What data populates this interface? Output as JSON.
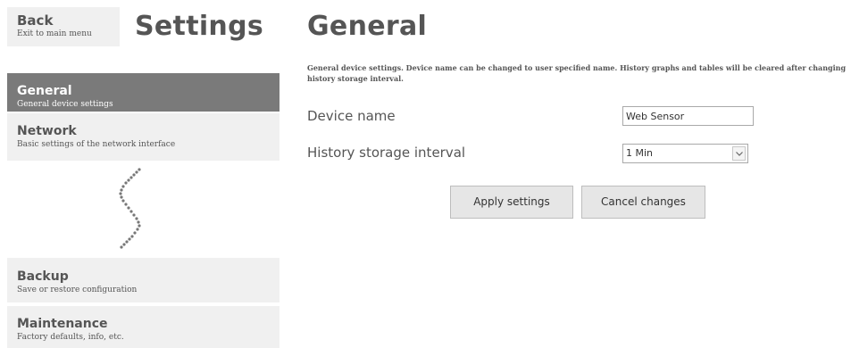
{
  "header": {
    "back": {
      "title": "Back",
      "subtitle": "Exit to main menu"
    },
    "settings_title": "Settings",
    "page_title": "General"
  },
  "sidebar": {
    "items": [
      {
        "title": "General",
        "subtitle": "General device settings",
        "active": true
      },
      {
        "title": "Network",
        "subtitle": "Basic settings of the network interface",
        "active": false
      },
      {
        "title": "Backup",
        "subtitle": "Save or restore configuration",
        "active": false
      },
      {
        "title": "Maintenance",
        "subtitle": "Factory defaults, info, etc.",
        "active": false
      }
    ]
  },
  "main": {
    "description": "General device settings. Device name can be changed to user specified name. History graphs and tables will be cleared after changing history storage interval.",
    "device_name": {
      "label": "Device name",
      "value": "Web Sensor"
    },
    "history_interval": {
      "label": "History storage interval",
      "selected": "1 Min"
    },
    "buttons": {
      "apply": "Apply settings",
      "cancel": "Cancel changes"
    }
  },
  "colors": {
    "active_nav": "#7a7a7a",
    "nav_bg": "#f0f0f0",
    "text": "#555555",
    "button_bg": "#e6e6e6"
  },
  "icons": {
    "gap_marker": "wavy-dotted-break-icon",
    "select_arrow": "chevron-down-icon"
  }
}
